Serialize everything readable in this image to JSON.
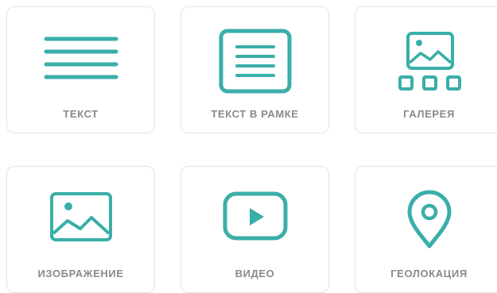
{
  "blocks": [
    {
      "id": "text",
      "label": "ТЕКСТ",
      "icon": "text-lines-icon"
    },
    {
      "id": "framed-text",
      "label": "ТЕКСТ В РАМКЕ",
      "icon": "framed-text-icon"
    },
    {
      "id": "gallery",
      "label": "ГАЛЕРЕЯ",
      "icon": "gallery-icon"
    },
    {
      "id": "image",
      "label": "ИЗОБРАЖЕНИЕ",
      "icon": "image-icon"
    },
    {
      "id": "video",
      "label": "ВИДЕО",
      "icon": "video-play-icon"
    },
    {
      "id": "geolocation",
      "label": "ГЕОЛОКАЦИЯ",
      "icon": "map-pin-icon"
    }
  ],
  "colors": {
    "icon": "#3aaea8",
    "label": "#8a8a8a",
    "border": "#e3e3e3"
  }
}
